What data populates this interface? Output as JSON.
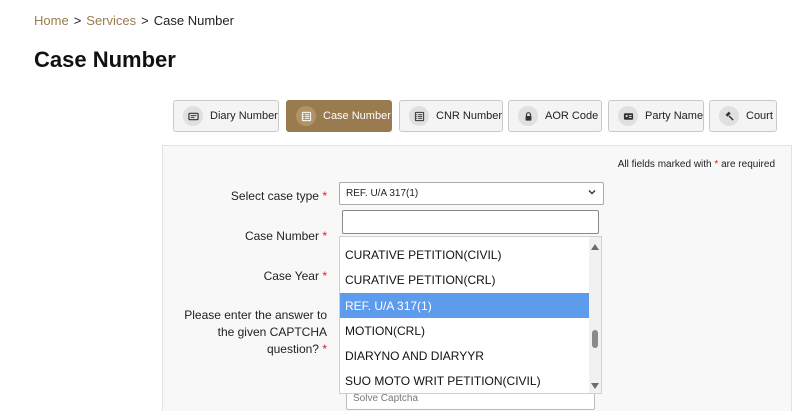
{
  "breadcrumb": {
    "home": "Home",
    "separator": ">",
    "services": "Services",
    "current": "Case Number"
  },
  "page_title": "Case Number",
  "tabs": [
    {
      "label": "Diary Number",
      "icon": "card-icon"
    },
    {
      "label": "Case Number",
      "icon": "list-icon",
      "active": true
    },
    {
      "label": "CNR Number",
      "icon": "list-icon"
    },
    {
      "label": "AOR Code",
      "icon": "lock-icon"
    },
    {
      "label": "Party Name",
      "icon": "id-card-icon"
    },
    {
      "label": "Court",
      "icon": "gavel-icon"
    }
  ],
  "form": {
    "required_note": "All fields marked with",
    "required_note_star": "*",
    "required_note_suffix": "are required",
    "case_type_label": "Select case type",
    "case_number_label": "Case Number",
    "case_year_label": "Case Year",
    "captcha_label": "Please enter the answer to the given CAPTCHA question?",
    "star": "*",
    "selected_case_type": "REF. U/A 317(1)",
    "search_value": "",
    "captcha_placeholder": "Solve Captcha"
  },
  "dropdown": {
    "items": [
      "CURATIVE PETITION(CIVIL)",
      "CURATIVE PETITION(CRL)",
      "REF. U/A 317(1)",
      "MOTION(CRL)",
      "DIARYNO AND DIARYYR",
      "SUO MOTO WRIT PETITION(CIVIL)"
    ],
    "selected_index": 2
  },
  "colors": {
    "accent": "#9a7b4f",
    "highlight": "#5d9cec",
    "required": "#dd2222"
  }
}
